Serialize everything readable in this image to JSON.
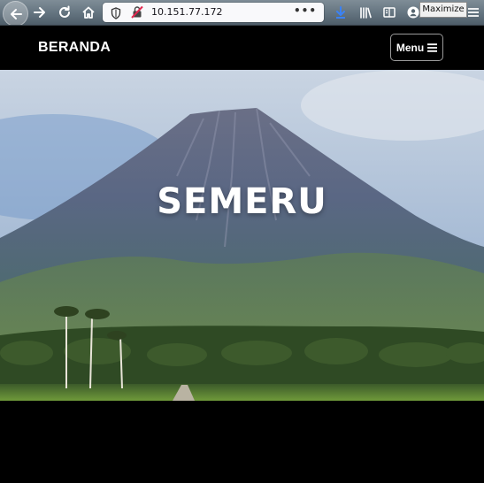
{
  "browser": {
    "url": "10.151.77.172",
    "page_actions": "•••",
    "tooltip": "Maximize"
  },
  "site": {
    "brand": "BERANDA",
    "menu_label": "Menu",
    "hero_title": "SEMERU"
  },
  "icons": [
    "back-arrow-icon",
    "forward-arrow-icon",
    "reload-icon",
    "home-icon",
    "shield-icon",
    "insecure-lock-icon",
    "download-icon",
    "library-icon",
    "reader-view-icon",
    "account-icon",
    "hamburger-icon"
  ],
  "colors": {
    "navbar": "#000000",
    "url_bar": "#f9f9fb",
    "download_accent": "#3b82f6"
  }
}
